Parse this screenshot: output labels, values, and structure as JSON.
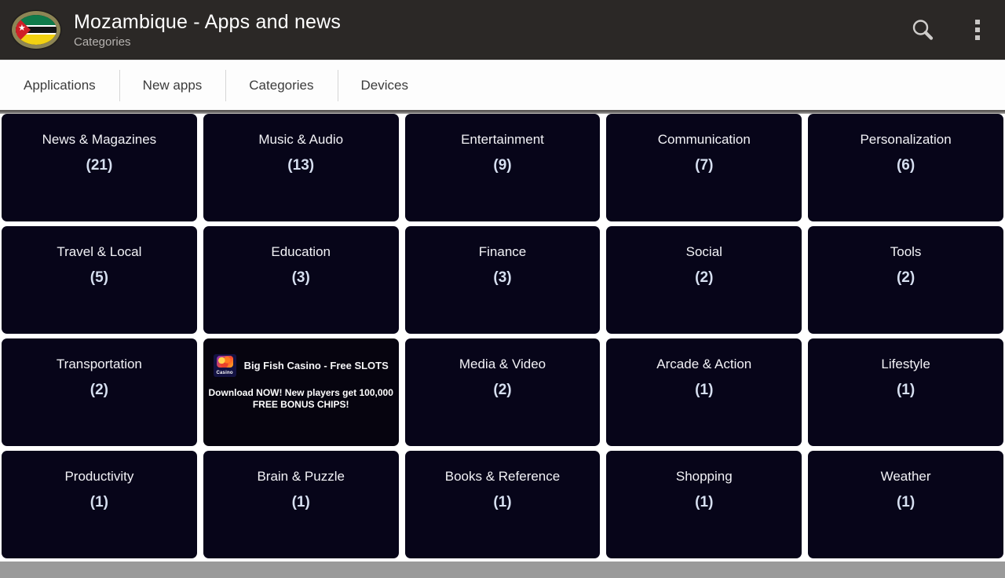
{
  "appbar": {
    "icon_name": "mozambique-flag-icon",
    "title": "Mozambique - Apps and news",
    "subtitle": "Categories",
    "search_icon": "search-icon",
    "overflow_icon": "overflow-menu-icon"
  },
  "tabs": [
    {
      "label": "Applications"
    },
    {
      "label": "New apps"
    },
    {
      "label": "Categories"
    },
    {
      "label": "Devices"
    }
  ],
  "colors": {
    "appbar_bg": "#2b2826",
    "tile_bg": "#070519",
    "tile_text": "#f2f2f6",
    "count_text": "#d6dff0",
    "tab_text": "#3c3c3c",
    "bottom_bar": "#9a9a9a"
  },
  "grid": {
    "tiles": [
      {
        "type": "category",
        "name": "News & Magazines",
        "count": "(21)"
      },
      {
        "type": "category",
        "name": "Music & Audio",
        "count": "(13)"
      },
      {
        "type": "category",
        "name": "Entertainment",
        "count": "(9)"
      },
      {
        "type": "category",
        "name": "Communication",
        "count": "(7)"
      },
      {
        "type": "category",
        "name": "Personalization",
        "count": "(6)"
      },
      {
        "type": "category",
        "name": "Travel & Local",
        "count": "(5)"
      },
      {
        "type": "category",
        "name": "Education",
        "count": "(3)"
      },
      {
        "type": "category",
        "name": "Finance",
        "count": "(3)"
      },
      {
        "type": "category",
        "name": "Social",
        "count": "(2)"
      },
      {
        "type": "category",
        "name": "Tools",
        "count": "(2)"
      },
      {
        "type": "category",
        "name": "Transportation",
        "count": "(2)"
      },
      {
        "type": "ad",
        "ad_title": "Big Fish Casino - Free SLOTS",
        "ad_body": "Download NOW! New players get 100,000 FREE BONUS CHIPS!",
        "ad_icon": "big-fish-casino-icon"
      },
      {
        "type": "category",
        "name": "Media & Video",
        "count": "(2)"
      },
      {
        "type": "category",
        "name": "Arcade & Action",
        "count": "(1)"
      },
      {
        "type": "category",
        "name": "Lifestyle",
        "count": "(1)"
      },
      {
        "type": "category",
        "name": "Productivity",
        "count": "(1)"
      },
      {
        "type": "category",
        "name": "Brain & Puzzle",
        "count": "(1)"
      },
      {
        "type": "category",
        "name": "Books & Reference",
        "count": "(1)"
      },
      {
        "type": "category",
        "name": "Shopping",
        "count": "(1)"
      },
      {
        "type": "category",
        "name": "Weather",
        "count": "(1)"
      }
    ]
  }
}
